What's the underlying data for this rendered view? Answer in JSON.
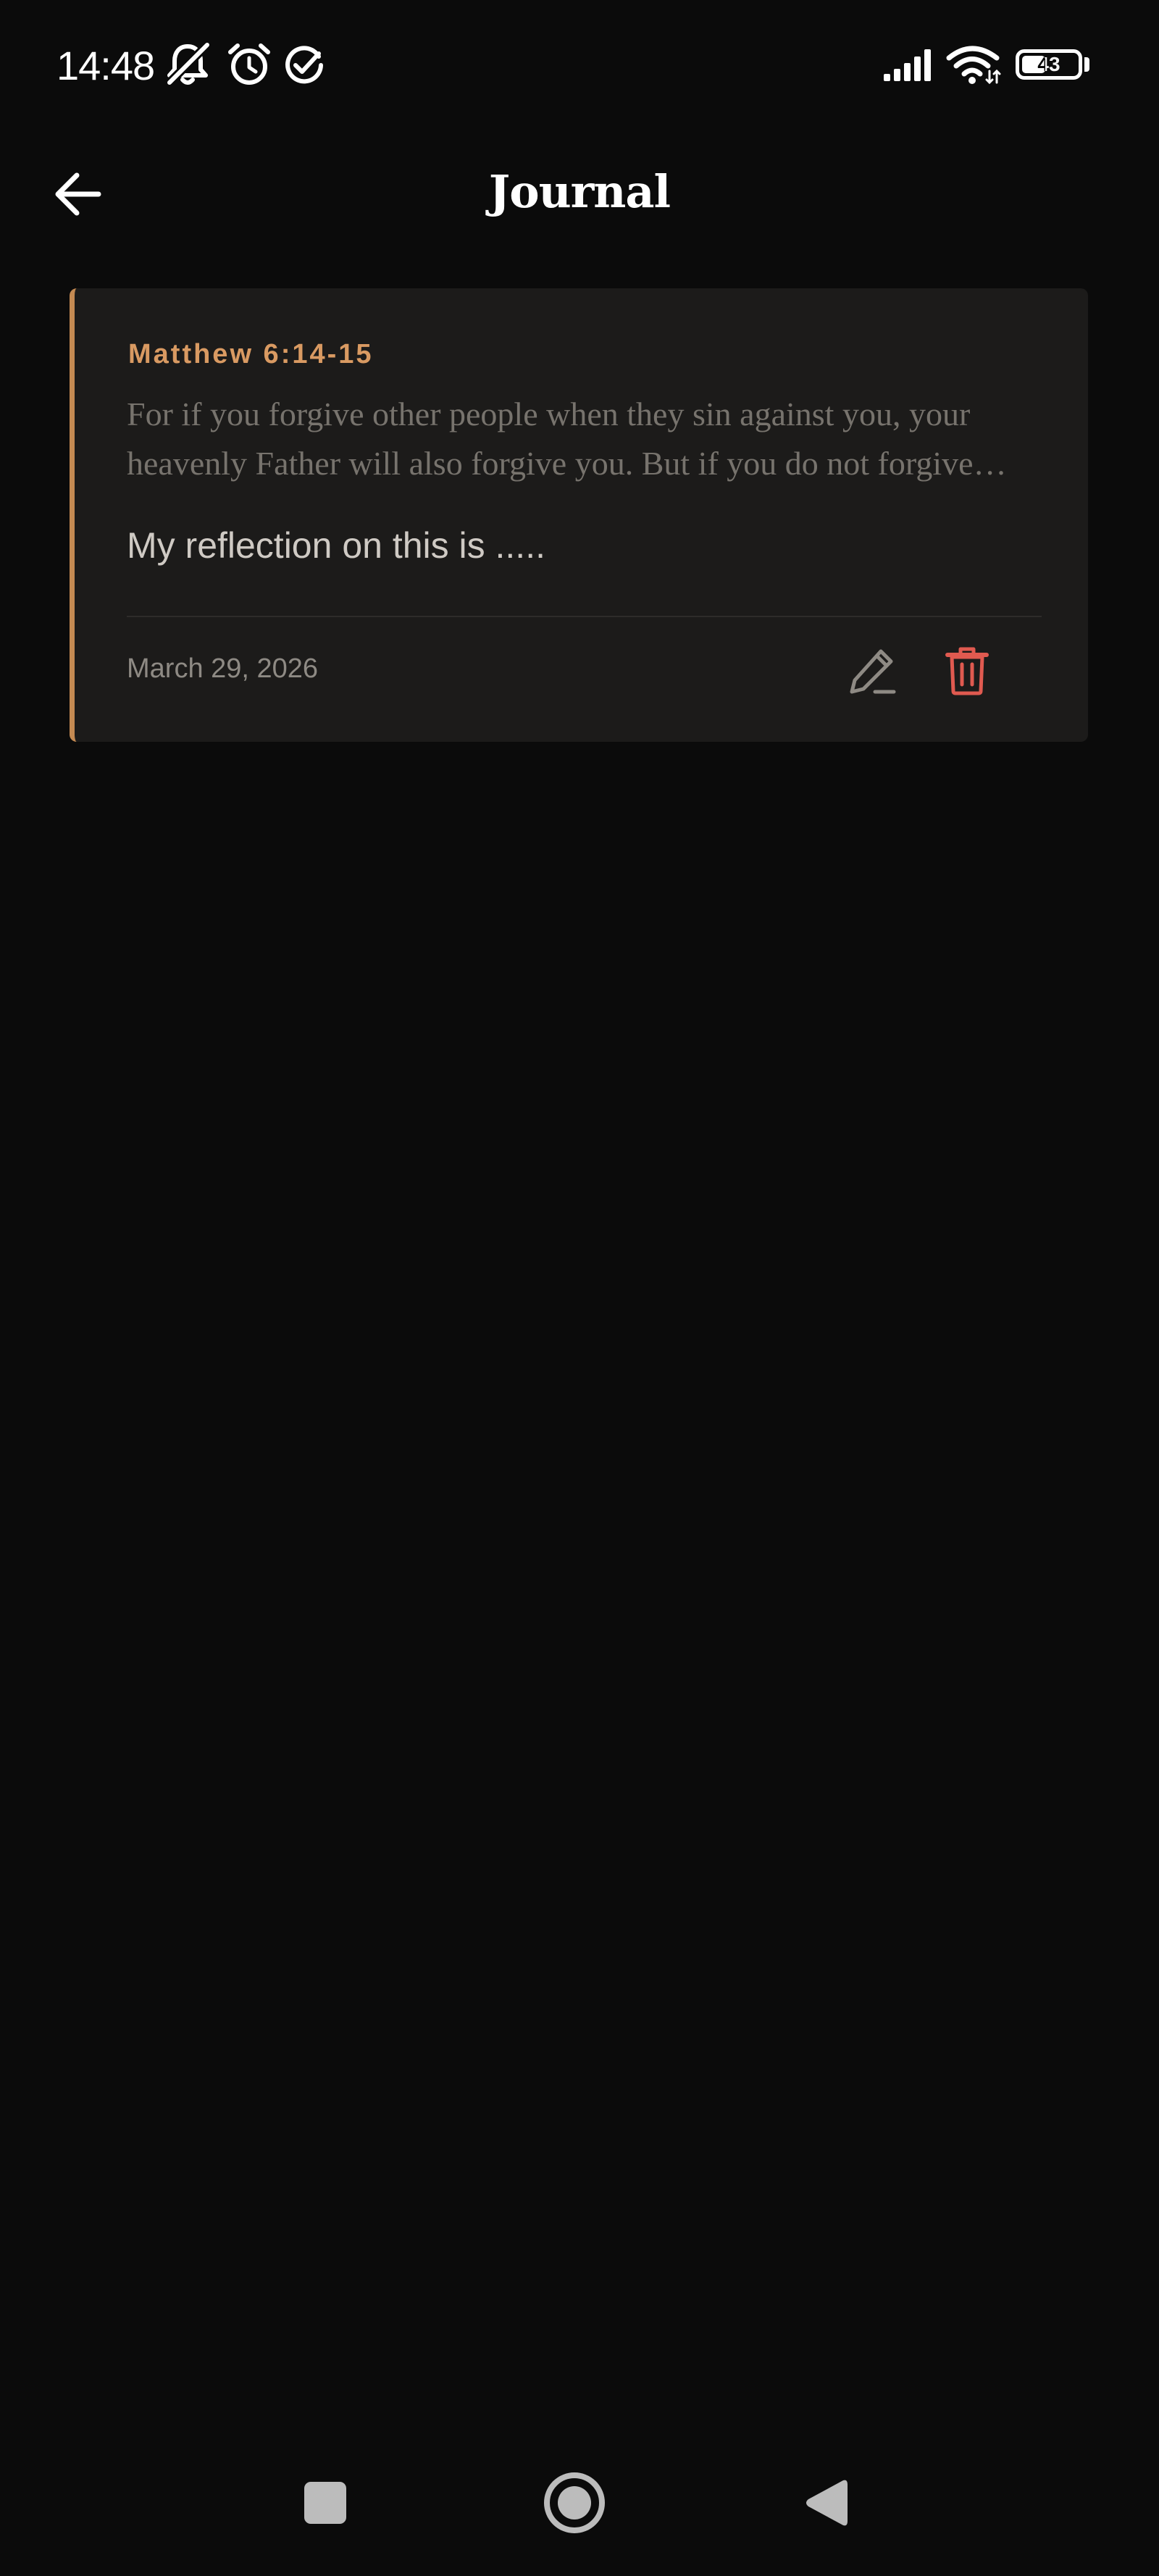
{
  "status_bar": {
    "time": "14:48",
    "battery_level": "43",
    "battery_fraction": 0.43,
    "icons": [
      "notifications-off-icon",
      "alarm-icon",
      "check-circle-icon",
      "signal-icon",
      "wifi-icon",
      "battery-icon"
    ]
  },
  "header": {
    "title": "Journal",
    "back_icon": "arrow-left-icon"
  },
  "entries": [
    {
      "reference": "Matthew 6:14-15",
      "verse": "For if you forgive other people when they sin against you, your heavenly Father will also forgive you. But if you do not forgive others their sins, your Father will not forgive your sins.",
      "reflection": "My reflection on this is .....",
      "date": "March 29, 2026",
      "edit_icon": "pencil-icon",
      "delete_icon": "trash-icon"
    }
  ],
  "nav_bar": {
    "icons": [
      "recents-square-icon",
      "home-circle-icon",
      "back-triangle-icon"
    ]
  },
  "colors": {
    "background": "#0b0b0b",
    "card_background": "#1c1b1a",
    "accent": "#c48a52",
    "reference": "#d99a62",
    "delete": "#e05a50"
  }
}
